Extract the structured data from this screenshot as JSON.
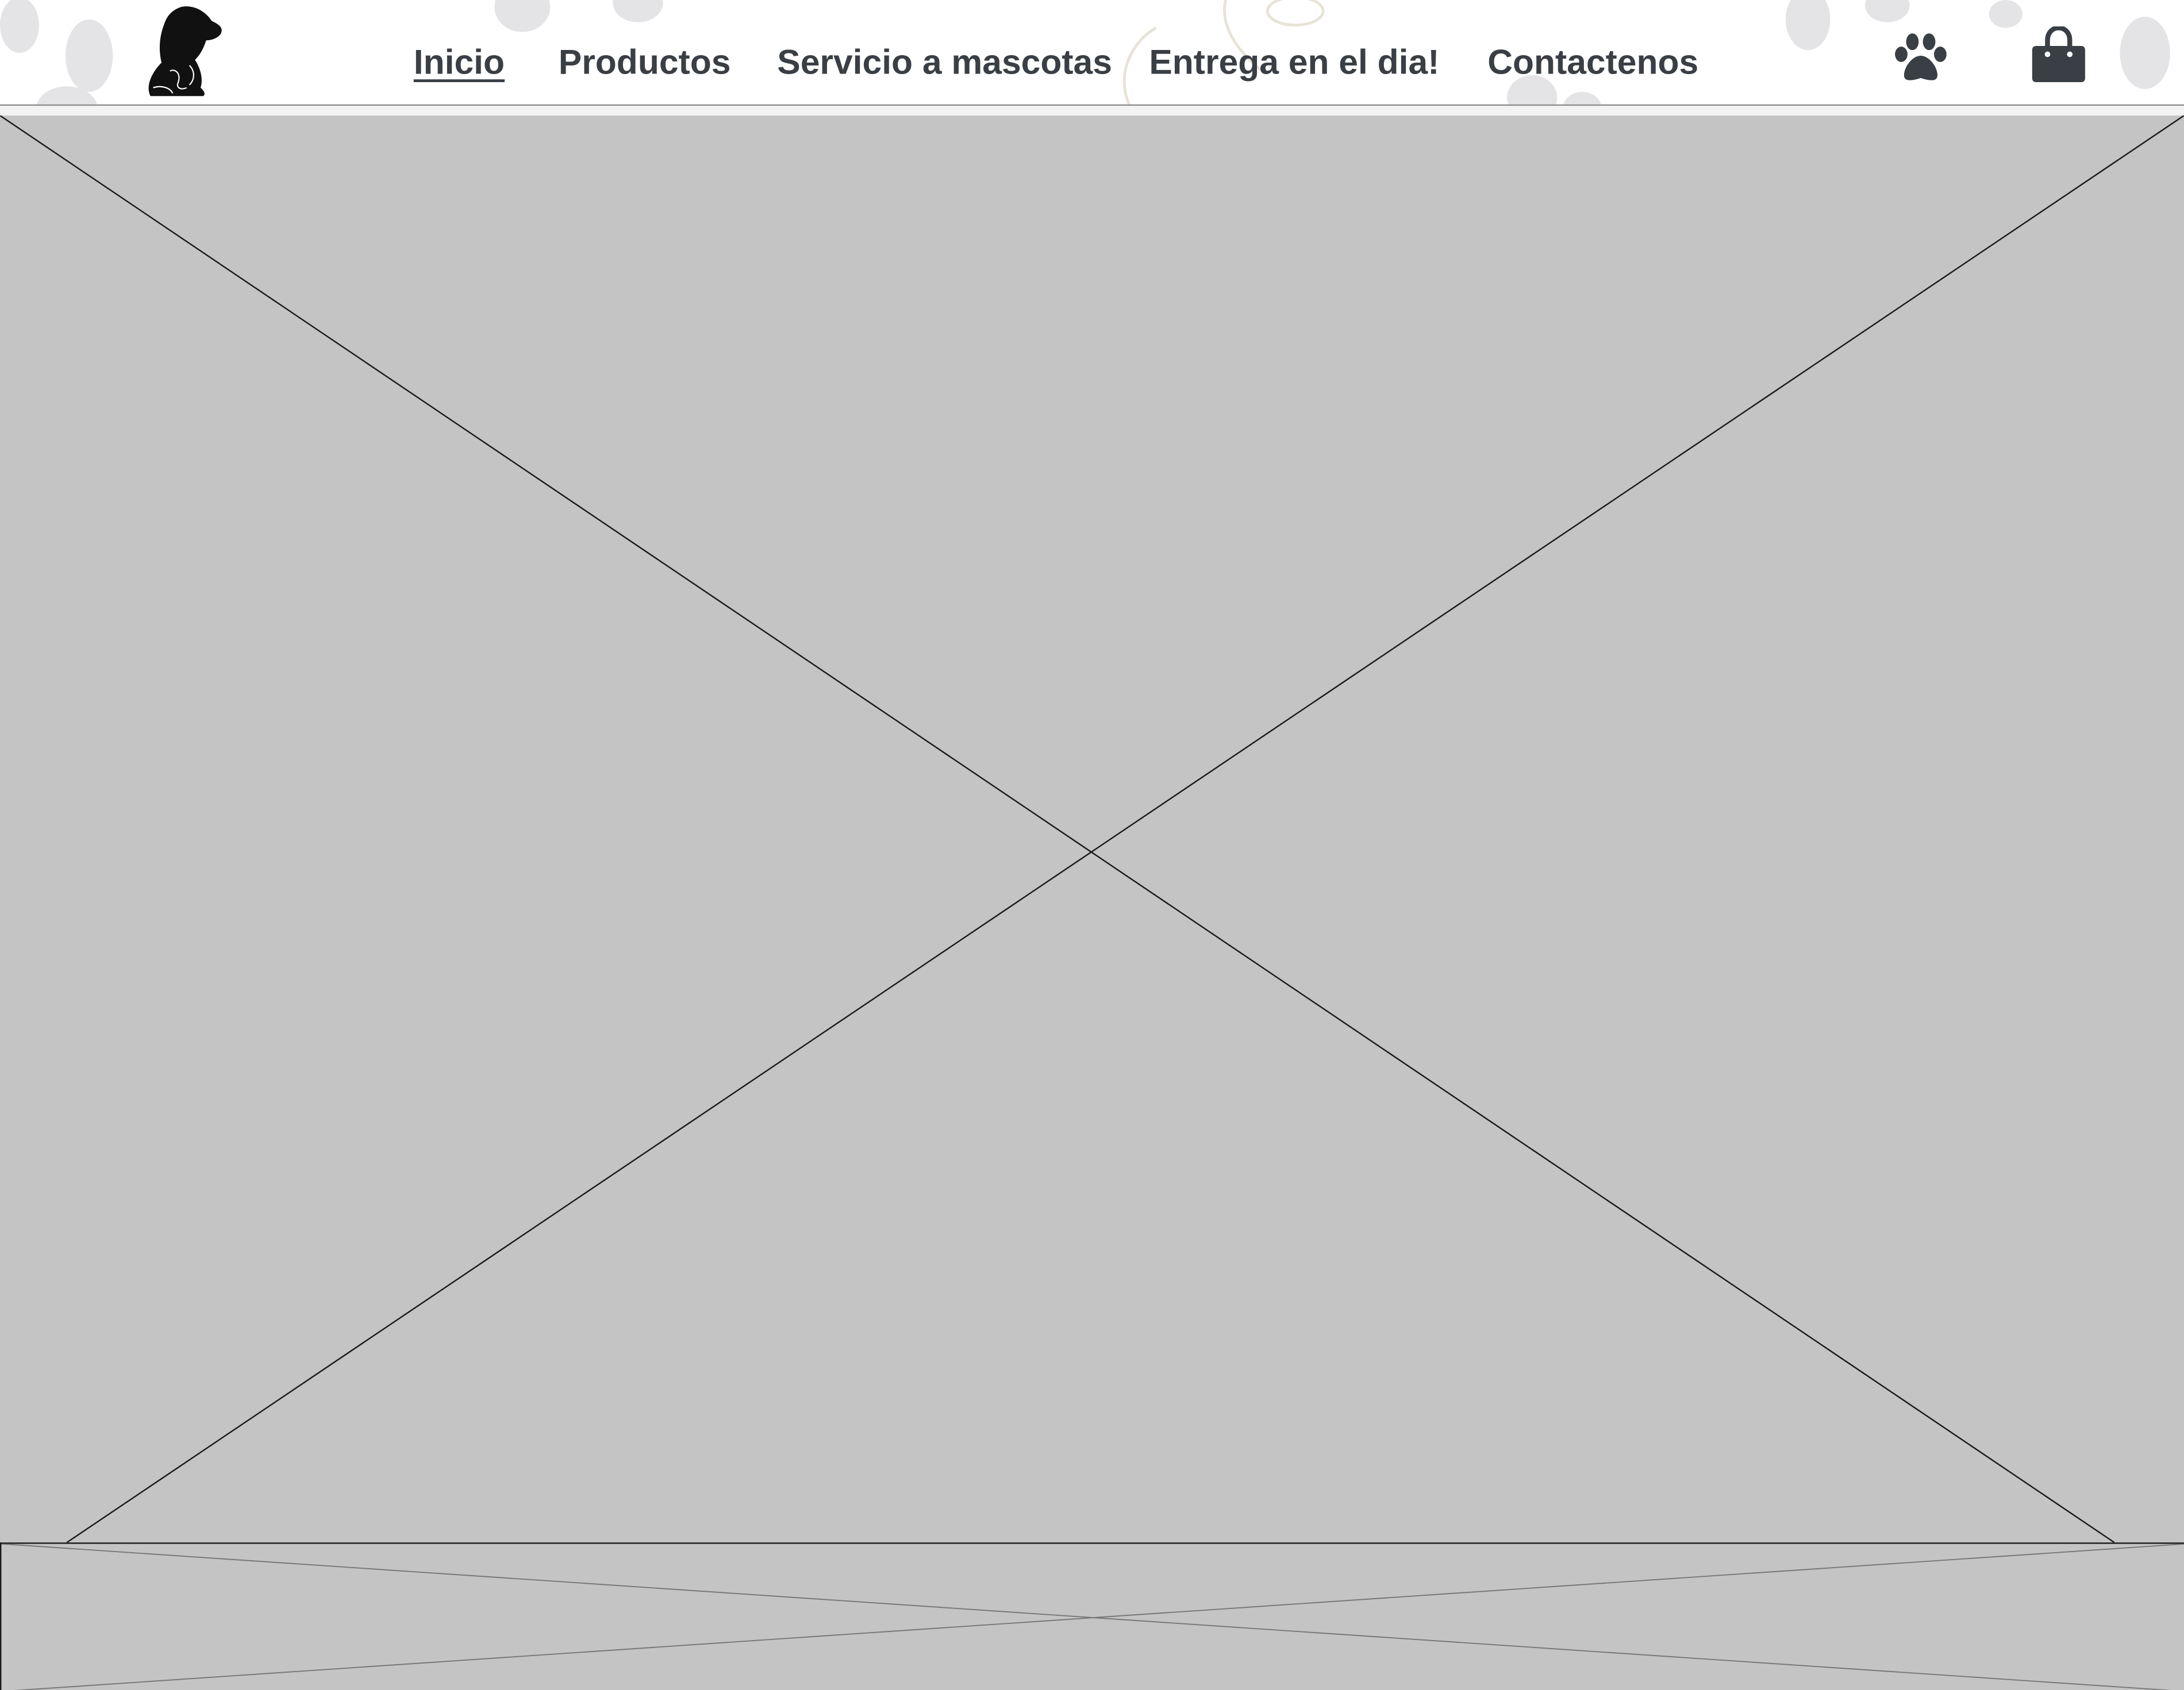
{
  "header": {
    "logo_icon": "dog-silhouette-logo",
    "nav": [
      {
        "label": "Inicio",
        "active": true
      },
      {
        "label": "Productos",
        "active": false
      },
      {
        "label": "Servicio a mascotas",
        "active": false
      },
      {
        "label": "Entrega en el dia!",
        "active": false
      },
      {
        "label": "Contactenos",
        "active": false
      }
    ],
    "actions": [
      {
        "icon": "paw-icon"
      },
      {
        "icon": "shopping-bag-icon"
      }
    ]
  },
  "hero": {
    "type": "image-placeholder"
  },
  "lower_banner": {
    "type": "image-placeholder"
  },
  "colors": {
    "nav_text": "#3a3f45",
    "placeholder_fill": "#c4c4c4",
    "icon_fill": "#3a3f45",
    "paw_watermark": "#e6e6e6"
  }
}
